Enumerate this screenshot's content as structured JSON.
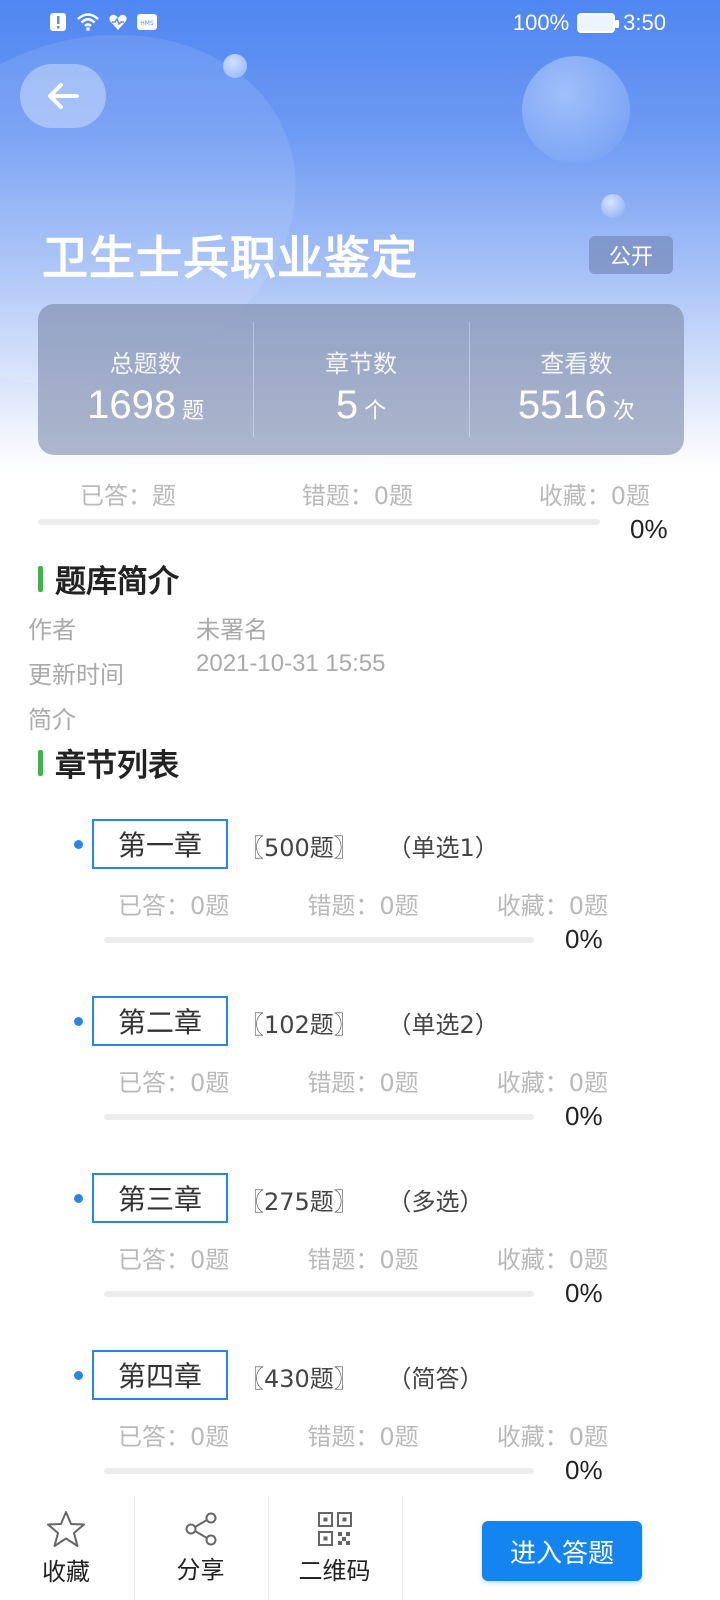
{
  "status_bar": {
    "battery": "100%",
    "time": "3:50",
    "icons": [
      "alert-icon",
      "wifi-icon",
      "health-icon",
      "hms-icon"
    ]
  },
  "header": {
    "title": "卫生士兵职业鉴定",
    "visibility_badge": "公开"
  },
  "stats": [
    {
      "label": "总题数",
      "value": "1698",
      "unit": "题"
    },
    {
      "label": "章节数",
      "value": "5",
      "unit": "个"
    },
    {
      "label": "查看数",
      "value": "5516",
      "unit": "次"
    }
  ],
  "overall": {
    "answered": "已答：题",
    "wrong": "错题：0题",
    "favorites": "收藏：0题",
    "percent": "0%",
    "progress": 0
  },
  "intro": {
    "title": "题库简介",
    "author_label": "作者",
    "author": "未署名",
    "updated_label": "更新时间",
    "updated": "2021-10-31 15:55",
    "summary_label": "简介",
    "summary": ""
  },
  "chapters_section": {
    "title": "章节列表",
    "items": [
      {
        "name": "第一章",
        "count": "〖500题〗",
        "type": "（单选1）",
        "answered": "已答：0题",
        "wrong": "错题：0题",
        "favorites": "收藏：0题",
        "percent": "0%",
        "progress": 0
      },
      {
        "name": "第二章",
        "count": "〖102题〗",
        "type": "（单选2）",
        "answered": "已答：0题",
        "wrong": "错题：0题",
        "favorites": "收藏：0题",
        "percent": "0%",
        "progress": 0
      },
      {
        "name": "第三章",
        "count": "〖275题〗",
        "type": "（多选）",
        "answered": "已答：0题",
        "wrong": "错题：0题",
        "favorites": "收藏：0题",
        "percent": "0%",
        "progress": 0
      },
      {
        "name": "第四章",
        "count": "〖430题〗",
        "type": "（简答）",
        "answered": "已答：0题",
        "wrong": "错题：0题",
        "favorites": "收藏：0题",
        "percent": "0%",
        "progress": 0
      }
    ]
  },
  "bottom_bar": {
    "favorite": "收藏",
    "share": "分享",
    "qrcode": "二维码",
    "enter": "进入答题"
  },
  "colors": {
    "accent": "#1485f0",
    "header_blue": "#4f86f1",
    "section_marker": "#3fb24a",
    "chapter_border": "#2a86e6"
  }
}
